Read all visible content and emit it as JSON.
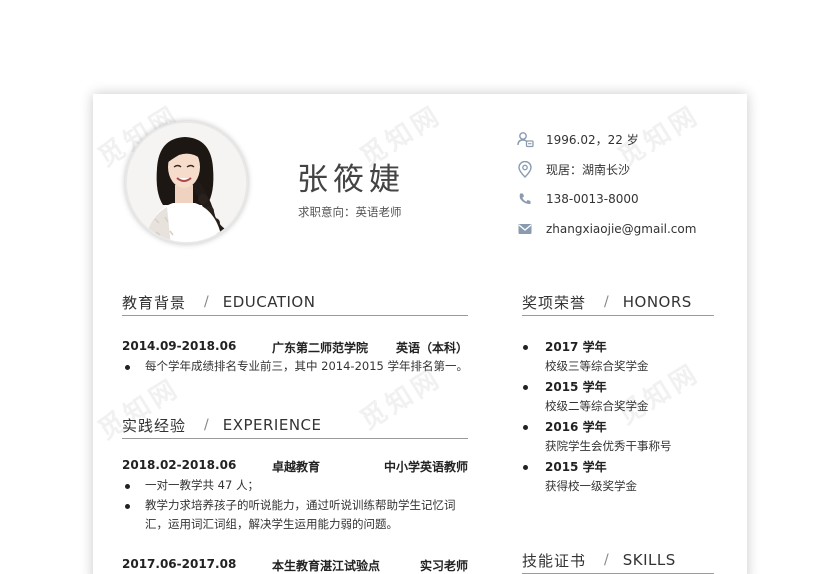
{
  "watermark": {
    "text": "觅知网"
  },
  "profile": {
    "name": "张筱婕",
    "objective": "求职意向：英语老师"
  },
  "contact": {
    "birth": "1996.02，22 岁",
    "location": "现居：湖南长沙",
    "phone": "138-0013-8000",
    "email": "zhangxiaojie@gmail.com",
    "icon_color": "#8a9bb0"
  },
  "education": {
    "heading_cn": "教育背景",
    "heading_en": "EDUCATION",
    "entries": [
      {
        "period": "2014.09-2018.06",
        "org": "广东第二师范学院",
        "role": "英语（本科）",
        "bullets": [
          "每个学年成绩排名专业前三，其中 2014-2015 学年排名第一。"
        ]
      }
    ]
  },
  "experience": {
    "heading_cn": "实践经验",
    "heading_en": "EXPERIENCE",
    "entries": [
      {
        "period": "2018.02-2018.06",
        "org": "卓越教育",
        "role": "中小学英语教师",
        "bullets": [
          "一对一教学共 47 人；",
          "教学力求培养孩子的听说能力，通过听说训练帮助学生记忆词汇，运用词汇词组，解决学生运用能力弱的问题。"
        ]
      },
      {
        "period": "2017.06-2017.08",
        "org": "本生教育湛江试验点",
        "role": "实习老师"
      }
    ]
  },
  "honors": {
    "heading_cn": "奖项荣誉",
    "heading_en": "HONORS",
    "items": [
      {
        "year": "2017 学年",
        "award": "校级三等综合奖学金"
      },
      {
        "year": "2015 学年",
        "award": "校级二等综合奖学金"
      },
      {
        "year": "2016 学年",
        "award": "获院学生会优秀干事称号"
      },
      {
        "year": "2015 学年",
        "award": "获得校一级奖学金"
      }
    ]
  },
  "skills": {
    "heading_cn": "技能证书",
    "heading_en": "SKILLS"
  }
}
